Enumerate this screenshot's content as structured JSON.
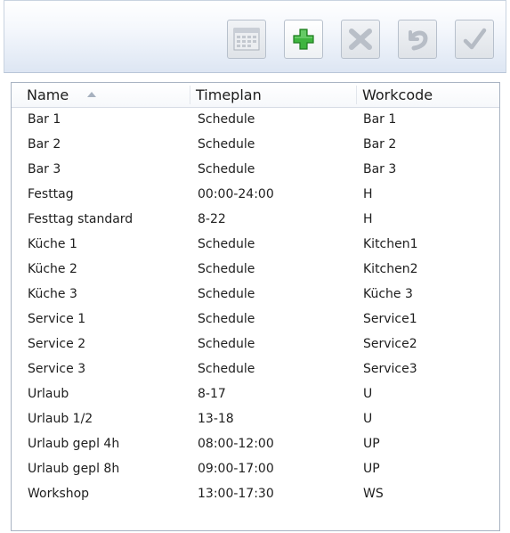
{
  "toolbar": {
    "buttons": [
      {
        "name": "calendar",
        "icon": "calendar-icon",
        "enabled": false
      },
      {
        "name": "add",
        "icon": "plus-icon",
        "enabled": true,
        "color": "#2ea52e"
      },
      {
        "name": "delete",
        "icon": "x-icon",
        "enabled": false
      },
      {
        "name": "undo",
        "icon": "undo-icon",
        "enabled": false
      },
      {
        "name": "confirm",
        "icon": "checkmark-icon",
        "enabled": false
      }
    ]
  },
  "table": {
    "columns": [
      {
        "label": "Name",
        "sorted": "ascending"
      },
      {
        "label": "Timeplan"
      },
      {
        "label": "Workcode"
      }
    ],
    "rows": [
      {
        "name": "Bar 1",
        "timeplan": "Schedule",
        "workcode": "Bar 1"
      },
      {
        "name": "Bar 2",
        "timeplan": "Schedule",
        "workcode": "Bar 2"
      },
      {
        "name": "Bar 3",
        "timeplan": "Schedule",
        "workcode": "Bar 3"
      },
      {
        "name": "Festtag",
        "timeplan": "00:00-24:00",
        "workcode": "H"
      },
      {
        "name": "Festtag standard",
        "timeplan": "8-22",
        "workcode": "H"
      },
      {
        "name": "Küche 1",
        "timeplan": "Schedule",
        "workcode": "Kitchen1"
      },
      {
        "name": "Küche 2",
        "timeplan": "Schedule",
        "workcode": "Kitchen2"
      },
      {
        "name": "Küche 3",
        "timeplan": "Schedule",
        "workcode": "Küche 3"
      },
      {
        "name": "Service 1",
        "timeplan": "Schedule",
        "workcode": "Service1"
      },
      {
        "name": "Service 2",
        "timeplan": "Schedule",
        "workcode": "Service2"
      },
      {
        "name": "Service 3",
        "timeplan": "Schedule",
        "workcode": "Service3"
      },
      {
        "name": "Urlaub",
        "timeplan": "8-17",
        "workcode": "U"
      },
      {
        "name": "Urlaub 1/2",
        "timeplan": "13-18",
        "workcode": "U"
      },
      {
        "name": "Urlaub gepl 4h",
        "timeplan": "08:00-12:00",
        "workcode": "UP"
      },
      {
        "name": "Urlaub gepl 8h",
        "timeplan": "09:00-17:00",
        "workcode": "UP"
      },
      {
        "name": "Workshop",
        "timeplan": "13:00-17:30",
        "workcode": "WS"
      }
    ]
  }
}
